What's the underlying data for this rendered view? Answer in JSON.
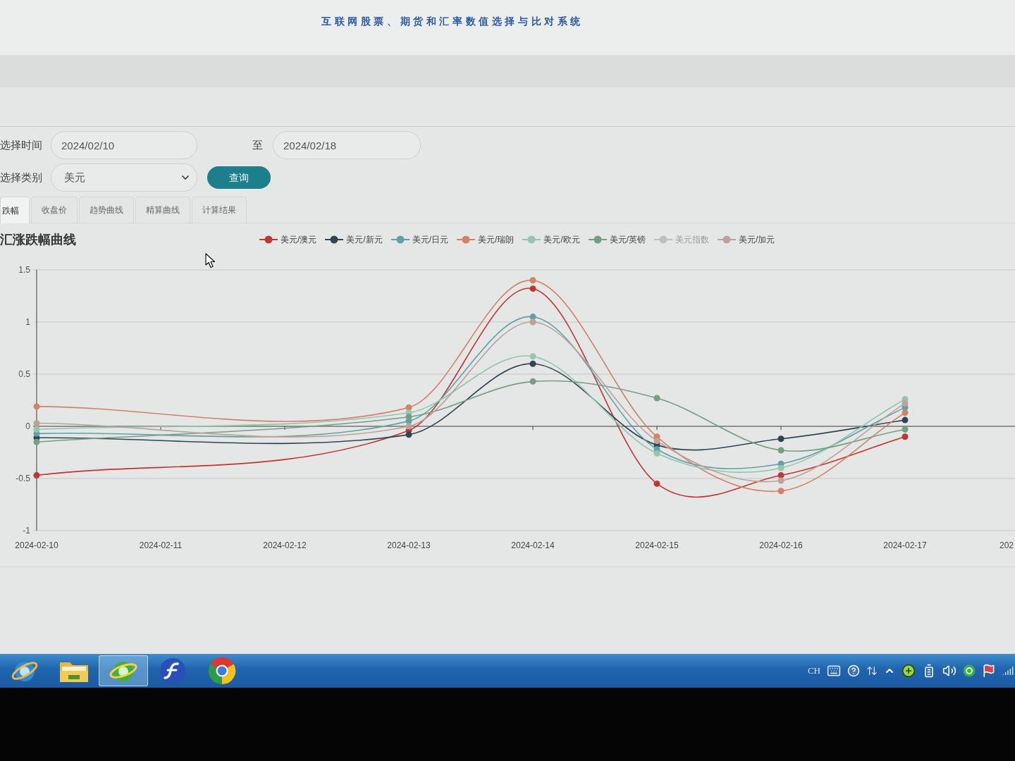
{
  "header": {
    "title": "互联网股票、期货和汇率数值选择与比对系统"
  },
  "query_form": {
    "date_label": "选择时间",
    "start_date": "2024/02/10",
    "range_separator": "至",
    "end_date": "2024/02/18",
    "category_label": "选择类别",
    "category": "美元",
    "submit_button": "查询"
  },
  "tabs": [
    {
      "label": "跌幅",
      "selected": true
    },
    {
      "label": "收盘价",
      "selected": false
    },
    {
      "label": "趋势曲线",
      "selected": false
    },
    {
      "label": "精算曲线",
      "selected": false
    },
    {
      "label": "计算结果",
      "selected": false
    }
  ],
  "chart_panel": {
    "title": "汇涨跌幅曲线",
    "legend": [
      {
        "label": "美元/澳元",
        "color": "#c23531",
        "selected": true
      },
      {
        "label": "美元/新元",
        "color": "#2f4554",
        "selected": true
      },
      {
        "label": "美元/日元",
        "color": "#61a0a8",
        "selected": true
      },
      {
        "label": "美元/瑞朗",
        "color": "#d48265",
        "selected": true
      },
      {
        "label": "美元/欧元",
        "color": "#91c7ae",
        "selected": true
      },
      {
        "label": "美元/英镑",
        "color": "#749f83",
        "selected": true
      },
      {
        "label": "美元指数",
        "selected": false
      },
      {
        "label": "美元/加元",
        "color": "#bda29a",
        "selected": true
      }
    ],
    "chart_data": {
      "type": "line",
      "categories": [
        "2024-02-10",
        "2024-02-11",
        "2024-02-12",
        "2024-02-13",
        "2024-02-14",
        "2024-02-15",
        "2024-02-16",
        "2024-02-17",
        "202"
      ],
      "ylim": [
        -1,
        1.5
      ],
      "yticks": [
        -1,
        -0.5,
        0,
        0.5,
        1,
        1.5
      ],
      "grid": true,
      "marker": "circle",
      "series": [
        {
          "color": "#c23531",
          "values": [
            -0.47,
            null,
            null,
            -0.04,
            1.32,
            -0.55,
            -0.47,
            -0.1,
            null
          ]
        },
        {
          "color": "#2f4554",
          "values": [
            -0.11,
            null,
            null,
            -0.08,
            0.6,
            -0.18,
            -0.12,
            0.06,
            null
          ]
        },
        {
          "color": "#61a0a8",
          "values": [
            -0.07,
            null,
            null,
            0.05,
            1.05,
            -0.22,
            -0.36,
            0.18,
            null
          ]
        },
        {
          "color": "#d48265",
          "values": [
            0.19,
            null,
            null,
            0.18,
            1.4,
            -0.1,
            -0.62,
            0.13,
            null
          ]
        },
        {
          "color": "#91c7ae",
          "values": [
            -0.03,
            null,
            null,
            0.13,
            0.67,
            -0.26,
            -0.4,
            0.26,
            null
          ]
        },
        {
          "color": "#749f83",
          "values": [
            -0.15,
            null,
            null,
            0.09,
            0.43,
            0.27,
            -0.23,
            -0.03,
            null
          ]
        },
        {
          "color": "#bda29a",
          "values": [
            0.03,
            null,
            null,
            0.0,
            1.0,
            -0.14,
            -0.52,
            0.22,
            null
          ]
        }
      ]
    }
  },
  "taskbar": {
    "apps": [
      {
        "kind": "blue-orbit",
        "active": false
      },
      {
        "kind": "folder",
        "active": false
      },
      {
        "kind": "green-orbit",
        "active": true
      },
      {
        "kind": "swoosh",
        "active": false
      },
      {
        "kind": "tricolor",
        "active": false
      }
    ],
    "tray": {
      "language": "CH"
    }
  }
}
